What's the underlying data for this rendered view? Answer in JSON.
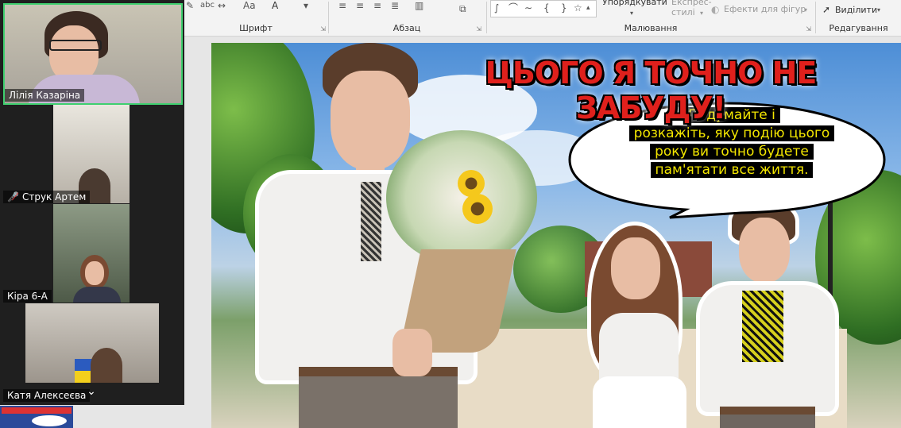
{
  "ribbon": {
    "groups": {
      "font": "Шрифт",
      "paragraph": "Абзац",
      "drawing": "Малювання",
      "editing": "Редагування"
    },
    "arrange": "Упорядкувати",
    "quick_styles": "Експрес-\nстилі",
    "shape_effects": "Ефекти для фігур",
    "select": "Виділити",
    "font_color_glyph": "A",
    "font_case_glyph": "Aa"
  },
  "participants": [
    {
      "name": "Лілія Казаріна",
      "muted": false,
      "active": true
    },
    {
      "name": "Струк Артем",
      "muted": true,
      "active": false
    },
    {
      "name": "Кіра 6-А",
      "muted": false,
      "active": false
    },
    {
      "name": "Катя Алексеєва",
      "muted": false,
      "active": false
    }
  ],
  "slide": {
    "title": "ЦЬОГО Я ТОЧНО НЕ ЗАБУДУ!",
    "bubble_lines": [
      "Подумайте і",
      "розкажіть, яку подію цього",
      "року ви точно будете",
      "пам'ятати все життя."
    ]
  },
  "colors": {
    "title_red": "#e0201c",
    "bubble_text": "#f3e600",
    "active_tile_border": "#3fcf6f",
    "panel_bg": "#1f1f1f"
  }
}
